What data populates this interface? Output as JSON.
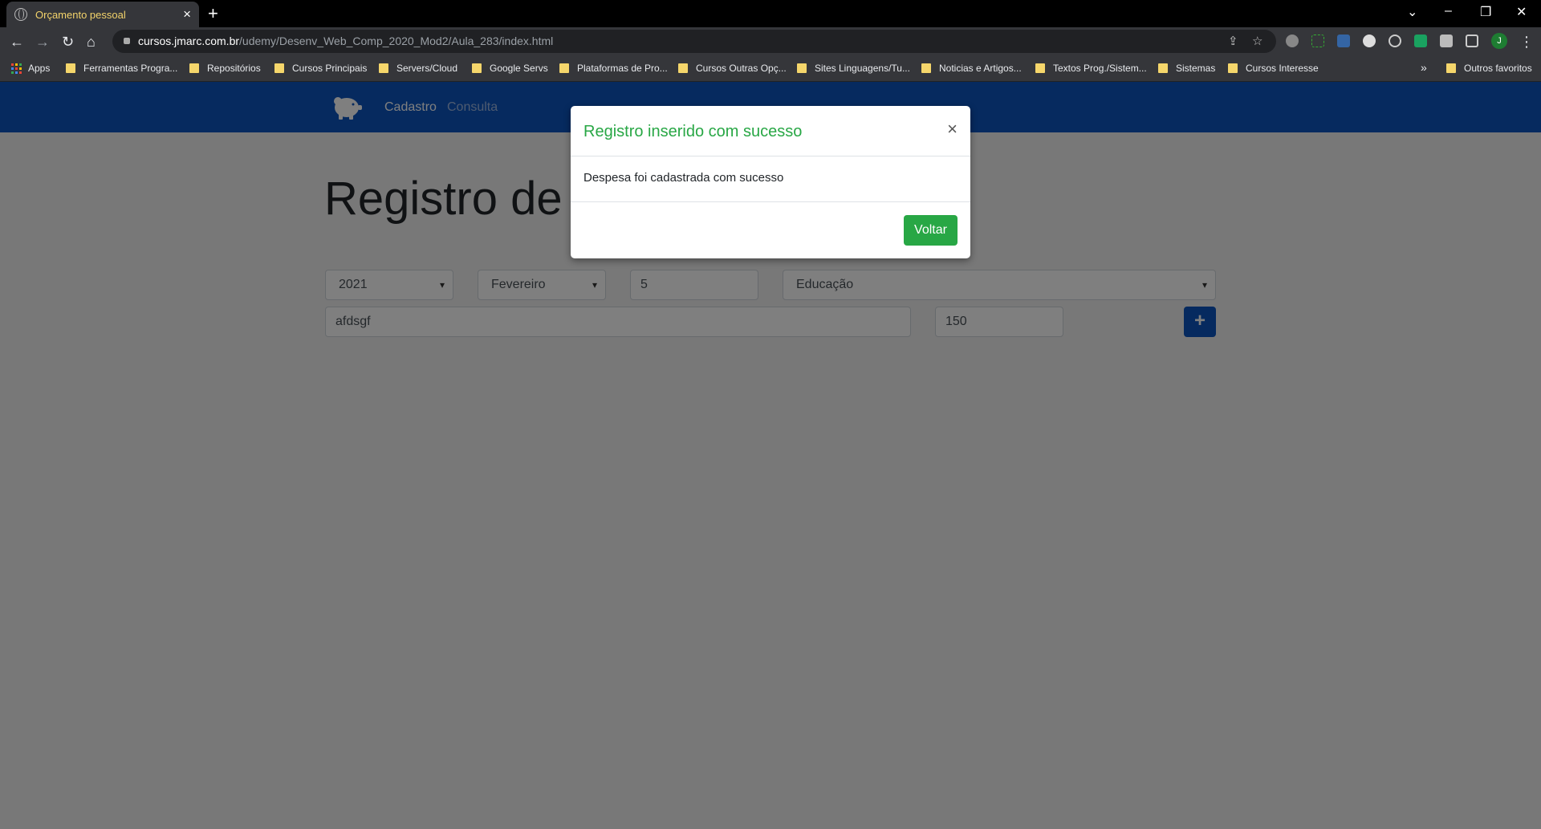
{
  "browser": {
    "tab_title": "Orçamento pessoal",
    "url_host": "cursos.jmarc.com.br",
    "url_path": "/udemy/Desenv_Web_Comp_2020_Mod2/Aula_283/index.html",
    "profile_initial": "J",
    "bookmarks": [
      "Apps",
      "Ferramentas Progra...",
      "Repositórios",
      "Cursos Principais",
      "Servers/Cloud",
      "Google Servs",
      "Plataformas de Pro...",
      "Cursos Outras Opç...",
      "Sites Linguagens/Tu...",
      "Noticias e Artigos...",
      "Textos Prog./Sistem...",
      "Sistemas",
      "Cursos Interesse"
    ],
    "more_bookmarks": "»",
    "other_favorites": "Outros favoritos"
  },
  "navbar": {
    "links": [
      "Cadastro",
      "Consulta"
    ],
    "accent": "#0c55be"
  },
  "main": {
    "heading": "Registro de nova despesa",
    "year": "2021",
    "month": "Fevereiro",
    "day": "5",
    "type": "Educação",
    "description": "afdsgf",
    "value": "150"
  },
  "modal": {
    "title": "Registro inserido com sucesso",
    "close_symbol": "×",
    "body": "Despesa foi cadastrada com sucesso",
    "button": "Voltar",
    "title_color": "#28a745"
  }
}
